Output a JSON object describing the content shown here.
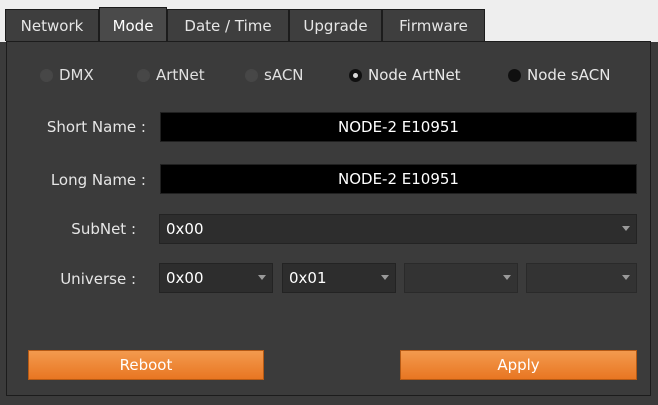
{
  "tabs": [
    {
      "label": "Network"
    },
    {
      "label": "Mode"
    },
    {
      "label": "Date / Time"
    },
    {
      "label": "Upgrade"
    },
    {
      "label": "Firmware"
    }
  ],
  "active_tab": "Mode",
  "modes": [
    {
      "label": "DMX",
      "checked": false
    },
    {
      "label": "ArtNet",
      "checked": false
    },
    {
      "label": "sACN",
      "checked": false
    },
    {
      "label": "Node ArtNet",
      "checked": true
    },
    {
      "label": "Node sACN",
      "checked": false
    }
  ],
  "fields": {
    "short_name_label": "Short Name :",
    "short_name_value": "NODE-2 E10951",
    "long_name_label": "Long Name :",
    "long_name_value": "NODE-2 E10951",
    "subnet_label": "SubNet :",
    "subnet_value": "0x00",
    "universe_label": "Universe :",
    "universe_values": [
      "0x00",
      "0x01",
      "",
      ""
    ]
  },
  "buttons": {
    "reboot": "Reboot",
    "apply": "Apply"
  },
  "colors": {
    "accent": "#e87622",
    "background": "#3b3b3b",
    "field": "#000000"
  }
}
